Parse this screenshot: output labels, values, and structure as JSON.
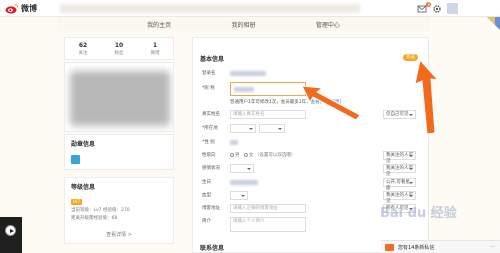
{
  "topbar": {
    "logo_text": "微博",
    "mail_count": "8"
  },
  "nav": {
    "items": [
      "我的主页",
      "我的相册",
      "管理中心"
    ]
  },
  "stats": [
    {
      "num": "62",
      "label": "关注"
    },
    {
      "num": "10",
      "label": "粉丝"
    },
    {
      "num": "1",
      "label": "微博"
    }
  ],
  "left": {
    "medal_title": "勋章信息",
    "level_title": "等级信息",
    "level_badge": "LV7",
    "level_line1": "当前等级：Lv7  经验值：270",
    "level_line2": "距离升级需经验值：68",
    "level_link": "查看详情 >"
  },
  "form": {
    "basic_title": "基本信息",
    "edit_label": "完成",
    "login_label": "登录名",
    "nickname_label": "*昵 称",
    "nickname_notice": "普通用户1年可修改1次，会员最多1年",
    "nickname_link": "，查看[昵称规则]",
    "realname_label": "真实姓名",
    "realname_placeholder": "请输入真实姓名",
    "realname_vis": "仅自己可见",
    "location_label": "*所在地",
    "gender_label": "*性 别",
    "sexual_label": "性取向",
    "sexual_male": "男",
    "sexual_female": "女",
    "sexual_note": "（设置可以双选哦）",
    "sexual_vis": "我关注的人可见",
    "relation_label": "感情状况",
    "relation_vis": "我关注的人可见",
    "birthday_label": "生日",
    "birthday_vis": "公开,可看星座",
    "blood_label": "血型",
    "blood_vis": "我关注的人可见",
    "blog_label": "博客地址",
    "blog_placeholder": "请输入正确的博客地址",
    "blog_vis": "所有人可见",
    "intro_label": "简介",
    "intro_placeholder": "请输入个人简介",
    "contact_title": "联系信息"
  },
  "chat": {
    "text": "您有14条新私信",
    "more": "···"
  },
  "watermark": {
    "text": "Bai du 经验"
  },
  "colors": {
    "accent": "#f36b24",
    "arrow": "#f26a1b",
    "edit_btn": "#f5a623",
    "link": "#3b7fc4"
  }
}
